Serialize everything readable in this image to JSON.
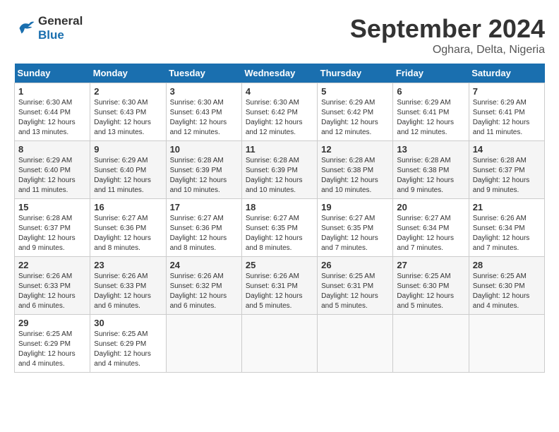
{
  "header": {
    "logo_line1": "General",
    "logo_line2": "Blue",
    "month": "September 2024",
    "location": "Oghara, Delta, Nigeria"
  },
  "days_of_week": [
    "Sunday",
    "Monday",
    "Tuesday",
    "Wednesday",
    "Thursday",
    "Friday",
    "Saturday"
  ],
  "weeks": [
    [
      {
        "day": "1",
        "info": "Sunrise: 6:30 AM\nSunset: 6:44 PM\nDaylight: 12 hours\nand 13 minutes."
      },
      {
        "day": "2",
        "info": "Sunrise: 6:30 AM\nSunset: 6:43 PM\nDaylight: 12 hours\nand 13 minutes."
      },
      {
        "day": "3",
        "info": "Sunrise: 6:30 AM\nSunset: 6:43 PM\nDaylight: 12 hours\nand 12 minutes."
      },
      {
        "day": "4",
        "info": "Sunrise: 6:30 AM\nSunset: 6:42 PM\nDaylight: 12 hours\nand 12 minutes."
      },
      {
        "day": "5",
        "info": "Sunrise: 6:29 AM\nSunset: 6:42 PM\nDaylight: 12 hours\nand 12 minutes."
      },
      {
        "day": "6",
        "info": "Sunrise: 6:29 AM\nSunset: 6:41 PM\nDaylight: 12 hours\nand 12 minutes."
      },
      {
        "day": "7",
        "info": "Sunrise: 6:29 AM\nSunset: 6:41 PM\nDaylight: 12 hours\nand 11 minutes."
      }
    ],
    [
      {
        "day": "8",
        "info": "Sunrise: 6:29 AM\nSunset: 6:40 PM\nDaylight: 12 hours\nand 11 minutes."
      },
      {
        "day": "9",
        "info": "Sunrise: 6:29 AM\nSunset: 6:40 PM\nDaylight: 12 hours\nand 11 minutes."
      },
      {
        "day": "10",
        "info": "Sunrise: 6:28 AM\nSunset: 6:39 PM\nDaylight: 12 hours\nand 10 minutes."
      },
      {
        "day": "11",
        "info": "Sunrise: 6:28 AM\nSunset: 6:39 PM\nDaylight: 12 hours\nand 10 minutes."
      },
      {
        "day": "12",
        "info": "Sunrise: 6:28 AM\nSunset: 6:38 PM\nDaylight: 12 hours\nand 10 minutes."
      },
      {
        "day": "13",
        "info": "Sunrise: 6:28 AM\nSunset: 6:38 PM\nDaylight: 12 hours\nand 9 minutes."
      },
      {
        "day": "14",
        "info": "Sunrise: 6:28 AM\nSunset: 6:37 PM\nDaylight: 12 hours\nand 9 minutes."
      }
    ],
    [
      {
        "day": "15",
        "info": "Sunrise: 6:28 AM\nSunset: 6:37 PM\nDaylight: 12 hours\nand 9 minutes."
      },
      {
        "day": "16",
        "info": "Sunrise: 6:27 AM\nSunset: 6:36 PM\nDaylight: 12 hours\nand 8 minutes."
      },
      {
        "day": "17",
        "info": "Sunrise: 6:27 AM\nSunset: 6:36 PM\nDaylight: 12 hours\nand 8 minutes."
      },
      {
        "day": "18",
        "info": "Sunrise: 6:27 AM\nSunset: 6:35 PM\nDaylight: 12 hours\nand 8 minutes."
      },
      {
        "day": "19",
        "info": "Sunrise: 6:27 AM\nSunset: 6:35 PM\nDaylight: 12 hours\nand 7 minutes."
      },
      {
        "day": "20",
        "info": "Sunrise: 6:27 AM\nSunset: 6:34 PM\nDaylight: 12 hours\nand 7 minutes."
      },
      {
        "day": "21",
        "info": "Sunrise: 6:26 AM\nSunset: 6:34 PM\nDaylight: 12 hours\nand 7 minutes."
      }
    ],
    [
      {
        "day": "22",
        "info": "Sunrise: 6:26 AM\nSunset: 6:33 PM\nDaylight: 12 hours\nand 6 minutes."
      },
      {
        "day": "23",
        "info": "Sunrise: 6:26 AM\nSunset: 6:33 PM\nDaylight: 12 hours\nand 6 minutes."
      },
      {
        "day": "24",
        "info": "Sunrise: 6:26 AM\nSunset: 6:32 PM\nDaylight: 12 hours\nand 6 minutes."
      },
      {
        "day": "25",
        "info": "Sunrise: 6:26 AM\nSunset: 6:31 PM\nDaylight: 12 hours\nand 5 minutes."
      },
      {
        "day": "26",
        "info": "Sunrise: 6:25 AM\nSunset: 6:31 PM\nDaylight: 12 hours\nand 5 minutes."
      },
      {
        "day": "27",
        "info": "Sunrise: 6:25 AM\nSunset: 6:30 PM\nDaylight: 12 hours\nand 5 minutes."
      },
      {
        "day": "28",
        "info": "Sunrise: 6:25 AM\nSunset: 6:30 PM\nDaylight: 12 hours\nand 4 minutes."
      }
    ],
    [
      {
        "day": "29",
        "info": "Sunrise: 6:25 AM\nSunset: 6:29 PM\nDaylight: 12 hours\nand 4 minutes."
      },
      {
        "day": "30",
        "info": "Sunrise: 6:25 AM\nSunset: 6:29 PM\nDaylight: 12 hours\nand 4 minutes."
      },
      {
        "day": "",
        "info": ""
      },
      {
        "day": "",
        "info": ""
      },
      {
        "day": "",
        "info": ""
      },
      {
        "day": "",
        "info": ""
      },
      {
        "day": "",
        "info": ""
      }
    ]
  ]
}
